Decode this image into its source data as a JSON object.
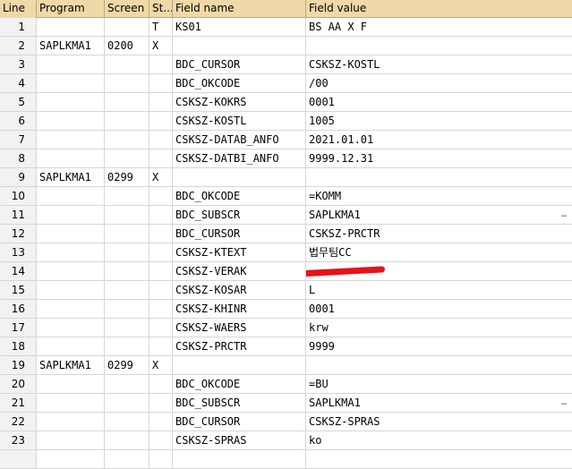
{
  "columns": {
    "line": "Line",
    "program": "Program",
    "screen": "Screen",
    "start": "St...",
    "field_name": "Field name",
    "field_value": "Field value"
  },
  "rows": [
    {
      "line": "1",
      "program": "",
      "screen": "",
      "start": "T",
      "field_name": "KS01",
      "field_value": "BS AA X    F"
    },
    {
      "line": "2",
      "program": "SAPLKMA1",
      "screen": "0200",
      "start": "X",
      "field_name": "",
      "field_value": ""
    },
    {
      "line": "3",
      "program": "",
      "screen": "",
      "start": "",
      "field_name": "BDC_CURSOR",
      "field_value": "CSKSZ-KOSTL"
    },
    {
      "line": "4",
      "program": "",
      "screen": "",
      "start": "",
      "field_name": "BDC_OKCODE",
      "field_value": "/00"
    },
    {
      "line": "5",
      "program": "",
      "screen": "",
      "start": "",
      "field_name": "CSKSZ-KOKRS",
      "field_value": "0001"
    },
    {
      "line": "6",
      "program": "",
      "screen": "",
      "start": "",
      "field_name": "CSKSZ-KOSTL",
      "field_value": "1005"
    },
    {
      "line": "7",
      "program": "",
      "screen": "",
      "start": "",
      "field_name": "CSKSZ-DATAB_ANFO",
      "field_value": "2021.01.01"
    },
    {
      "line": "8",
      "program": "",
      "screen": "",
      "start": "",
      "field_name": "CSKSZ-DATBI_ANFO",
      "field_value": "9999.12.31"
    },
    {
      "line": "9",
      "program": "SAPLKMA1",
      "screen": "0299",
      "start": "X",
      "field_name": "",
      "field_value": ""
    },
    {
      "line": "10",
      "program": "",
      "screen": "",
      "start": "",
      "field_name": "BDC_OKCODE",
      "field_value": "=KOMM"
    },
    {
      "line": "11",
      "program": "",
      "screen": "",
      "start": "",
      "field_name": "BDC_SUBSCR",
      "field_value": "SAPLKMA1"
    },
    {
      "line": "12",
      "program": "",
      "screen": "",
      "start": "",
      "field_name": "BDC_CURSOR",
      "field_value": "CSKSZ-PRCTR"
    },
    {
      "line": "13",
      "program": "",
      "screen": "",
      "start": "",
      "field_name": "CSKSZ-KTEXT",
      "field_value": "법무팀CC"
    },
    {
      "line": "14",
      "program": "",
      "screen": "",
      "start": "",
      "field_name": "CSKSZ-VERAK",
      "field_value": ""
    },
    {
      "line": "15",
      "program": "",
      "screen": "",
      "start": "",
      "field_name": "CSKSZ-KOSAR",
      "field_value": "L"
    },
    {
      "line": "16",
      "program": "",
      "screen": "",
      "start": "",
      "field_name": "CSKSZ-KHINR",
      "field_value": "0001"
    },
    {
      "line": "17",
      "program": "",
      "screen": "",
      "start": "",
      "field_name": "CSKSZ-WAERS",
      "field_value": "krw"
    },
    {
      "line": "18",
      "program": "",
      "screen": "",
      "start": "",
      "field_name": "CSKSZ-PRCTR",
      "field_value": "9999"
    },
    {
      "line": "19",
      "program": "SAPLKMA1",
      "screen": "0299",
      "start": "X",
      "field_name": "",
      "field_value": ""
    },
    {
      "line": "20",
      "program": "",
      "screen": "",
      "start": "",
      "field_name": "BDC_OKCODE",
      "field_value": "=BU"
    },
    {
      "line": "21",
      "program": "",
      "screen": "",
      "start": "",
      "field_name": "BDC_SUBSCR",
      "field_value": "SAPLKMA1"
    },
    {
      "line": "22",
      "program": "",
      "screen": "",
      "start": "",
      "field_name": "BDC_CURSOR",
      "field_value": "CSKSZ-SPRAS"
    },
    {
      "line": "23",
      "program": "",
      "screen": "",
      "start": "",
      "field_name": "CSKSZ-SPRAS",
      "field_value": "ko"
    }
  ],
  "more_marker": "…"
}
